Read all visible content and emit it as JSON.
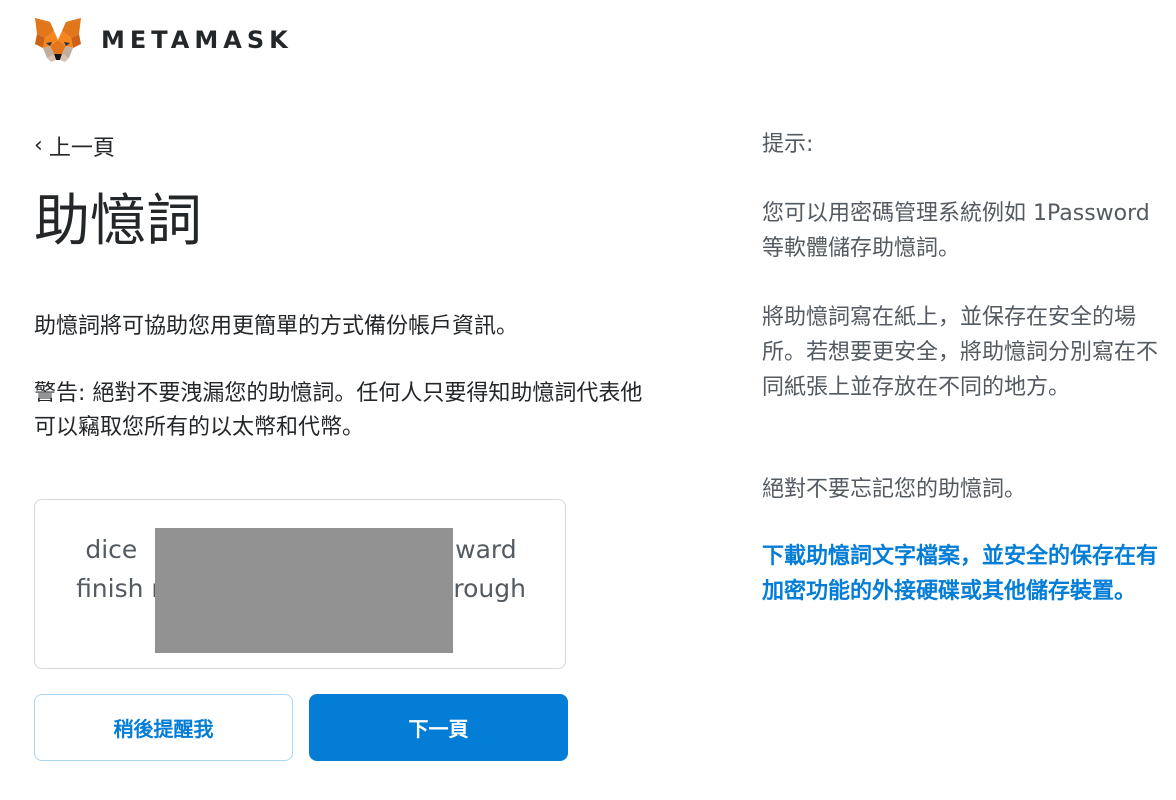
{
  "header": {
    "brand": "METAMASK",
    "logo_icon": "metamask-fox-icon"
  },
  "nav": {
    "back_label": "上一頁"
  },
  "main": {
    "title": "助憶詞",
    "description": "助憶詞將可協助您用更簡單的方式備份帳戶資訊。",
    "warning": "警告: 絕對不要洩漏您的助憶詞。任何人只要得知助憶詞代表他可以竊取您所有的以太幣和代幣。",
    "phrase_line1": "dice                                        ward",
    "phrase_line2": "finish n                                    rough"
  },
  "buttons": {
    "remind_later": "稍後提醒我",
    "next": "下一頁"
  },
  "tips": {
    "heading": "提示:",
    "tip1": "您可以用密碼管理系統例如 1Password 等軟體儲存助憶詞。",
    "tip2": "將助憶詞寫在紙上，並保存在安全的場所。若想要更安全，將助憶詞分別寫在不同紙張上並存放在不同的地方。",
    "tip3": "絕對不要忘記您的助憶詞。",
    "download_link": "下載助憶詞文字檔案，並安全的保存在有加密功能的外接硬碟或其他儲存裝置。"
  },
  "colors": {
    "accent": "#037dd6",
    "text": "#24272a",
    "muted": "#535a61",
    "mask": "#929292",
    "fox_orange": "#e2761b"
  }
}
